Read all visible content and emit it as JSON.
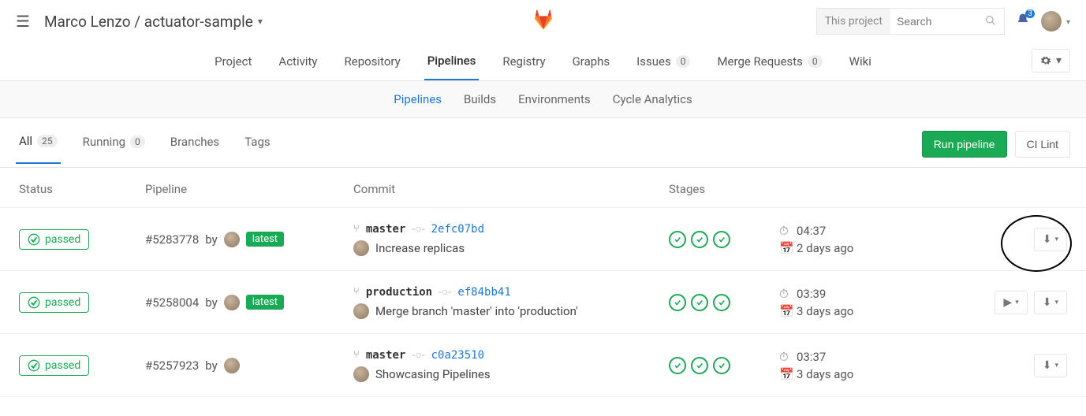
{
  "header": {
    "breadcrumb": "Marco Lenzo / actuator-sample",
    "search_scope": "This project",
    "search_placeholder": "Search",
    "notif_count": "3"
  },
  "nav1": [
    {
      "label": "Project"
    },
    {
      "label": "Activity"
    },
    {
      "label": "Repository"
    },
    {
      "label": "Pipelines",
      "active": true
    },
    {
      "label": "Registry"
    },
    {
      "label": "Graphs"
    },
    {
      "label": "Issues",
      "count": "0"
    },
    {
      "label": "Merge Requests",
      "count": "0"
    },
    {
      "label": "Wiki"
    }
  ],
  "nav2": [
    {
      "label": "Pipelines",
      "active": true
    },
    {
      "label": "Builds"
    },
    {
      "label": "Environments"
    },
    {
      "label": "Cycle Analytics"
    }
  ],
  "filters": {
    "tabs": [
      {
        "label": "All",
        "count": "25",
        "active": true
      },
      {
        "label": "Running",
        "count": "0"
      },
      {
        "label": "Branches"
      },
      {
        "label": "Tags"
      }
    ],
    "run_label": "Run pipeline",
    "lint_label": "CI Lint"
  },
  "columns": {
    "status": "Status",
    "pipeline": "Pipeline",
    "commit": "Commit",
    "stages": "Stages"
  },
  "rows": [
    {
      "status": "passed",
      "id": "#5283778",
      "by": "by",
      "latest": "latest",
      "branch": "master",
      "sha": "2efc07bd",
      "message": "Increase replicas",
      "stages": 3,
      "duration": "04:37",
      "age": "2 days ago",
      "has_retry": false,
      "highlight": true
    },
    {
      "status": "passed",
      "id": "#5258004",
      "by": "by",
      "latest": "latest",
      "branch": "production",
      "sha": "ef84bb41",
      "message": "Merge branch 'master' into 'production'",
      "stages": 3,
      "duration": "03:39",
      "age": "3 days ago",
      "has_retry": true
    },
    {
      "status": "passed",
      "id": "#5257923",
      "by": "by",
      "latest": "",
      "branch": "master",
      "sha": "c0a23510",
      "message": "Showcasing Pipelines",
      "stages": 3,
      "duration": "03:37",
      "age": "3 days ago",
      "has_retry": false
    }
  ]
}
